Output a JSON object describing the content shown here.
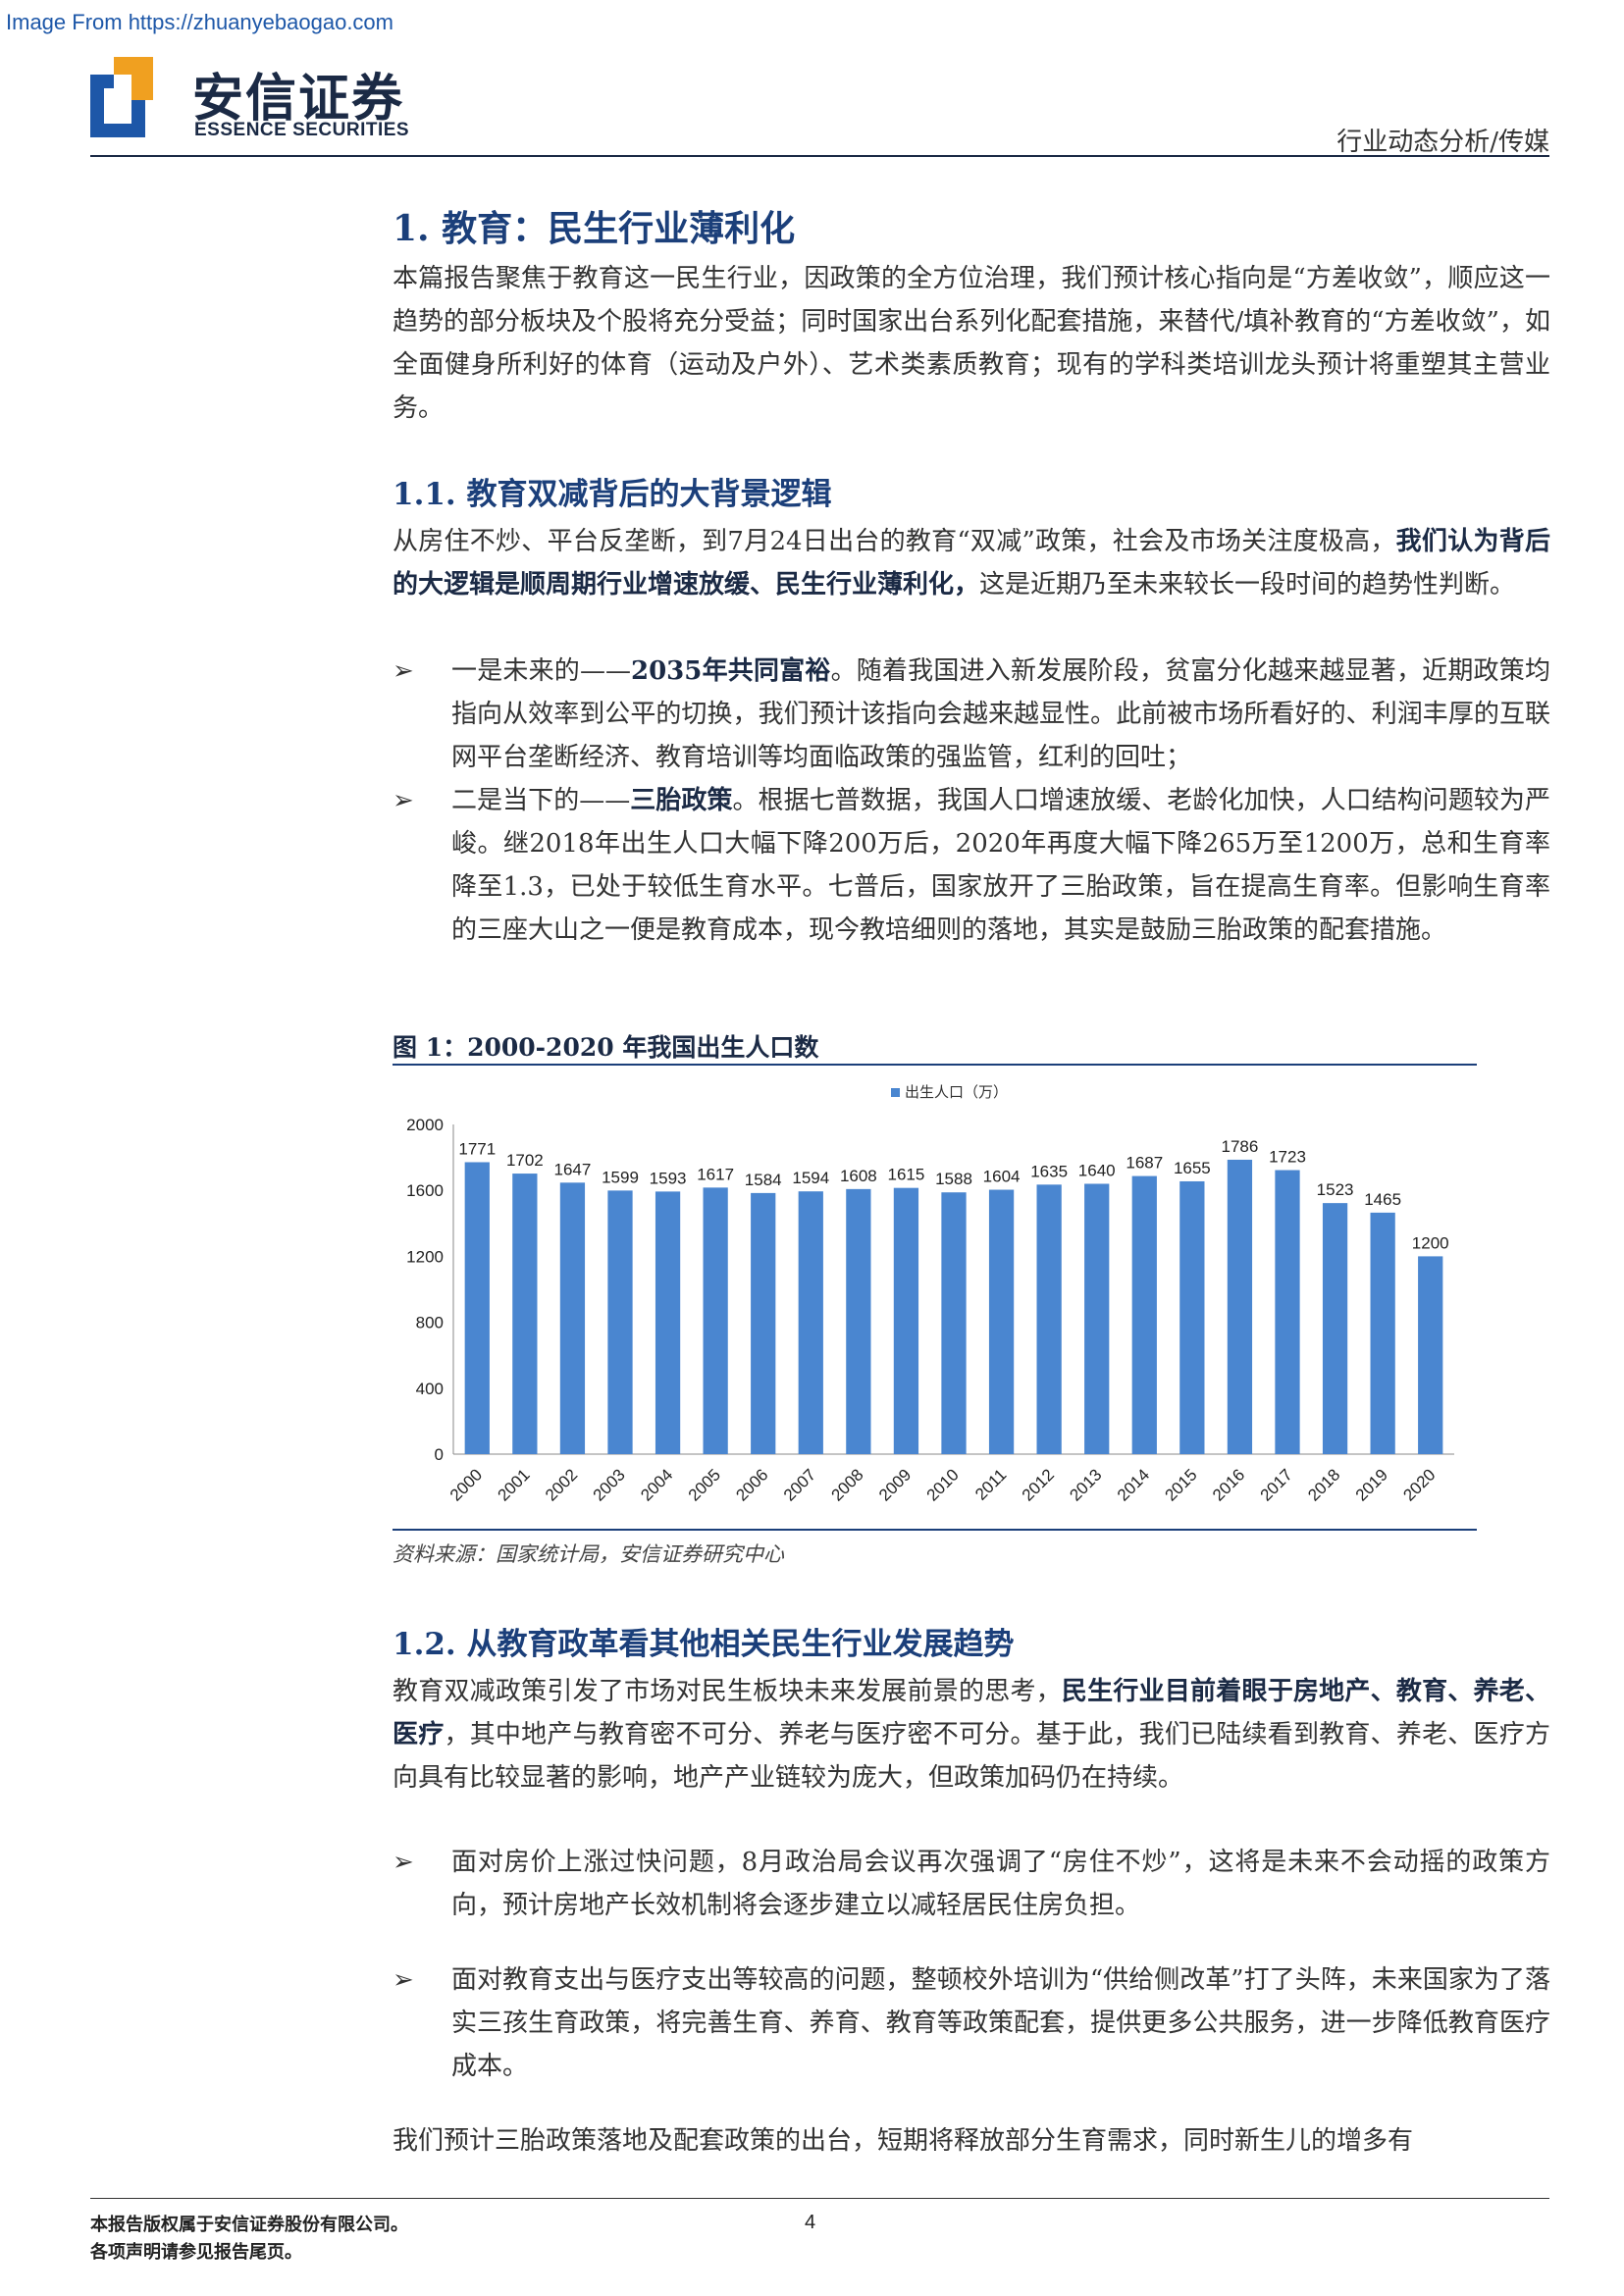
{
  "watermark": "Image From https://zhuanyebaogao.com",
  "logo": {
    "cn": "安信证券",
    "en": "ESSENCE SECURITIES",
    "brand_color": "#1d57a8",
    "accent_color": "#f0a020"
  },
  "header_right": "行业动态分析/传媒",
  "sec1": {
    "title": "1. 教育：民生行业薄利化",
    "para": "本篇报告聚焦于教育这一民生行业，因政策的全方位治理，我们预计核心指向是“方差收敛”，顺应这一趋势的部分板块及个股将充分受益；同时国家出台系列化配套措施，来替代/填补教育的“方差收敛”，如全面健身所利好的体育（运动及户外）、艺术类素质教育；现有的学科类培训龙头预计将重塑其主营业务。"
  },
  "sec11": {
    "title": "1.1. 教育双减背后的大背景逻辑",
    "para_a": "从房住不炒、平台反垄断，到7月24日出台的教育“双减”政策，社会及市场关注度极高，",
    "para_bold": "我们认为背后的大逻辑是顺周期行业增速放缓、民生行业薄利化，",
    "para_c": "这是近期乃至未来较长一段时间的趋势性判断。",
    "bullet1_a": "一是未来的——",
    "bullet1_bold": "2035年共同富裕",
    "bullet1_c": "。随着我国进入新发展阶段，贫富分化越来越显著，近期政策均指向从效率到公平的切换，我们预计该指向会越来越显性。此前被市场所看好的、利润丰厚的互联网平台垄断经济、教育培训等均面临政策的强监管，红利的回吐；",
    "bullet2_a": "二是当下的——",
    "bullet2_bold": "三胎政策",
    "bullet2_c": "。根据七普数据，我国人口增速放缓、老龄化加快，人口结构问题较为严峻。继2018年出生人口大幅下降200万后，2020年再度大幅下降265万至1200万，总和生育率降至1.3，已处于较低生育水平。七普后，国家放开了三胎政策，旨在提高生育率。但影响生育率的三座大山之一便是教育成本，现今教培细则的落地，其实是鼓励三胎政策的配套措施。"
  },
  "figure": {
    "title": "图 1：2000-2020 年我国出生人口数",
    "source": "资料来源：国家统计局，安信证券研究中心"
  },
  "chart_data": {
    "type": "bar",
    "categories": [
      "2000",
      "2001",
      "2002",
      "2003",
      "2004",
      "2005",
      "2006",
      "2007",
      "2008",
      "2009",
      "2010",
      "2011",
      "2012",
      "2013",
      "2014",
      "2015",
      "2016",
      "2017",
      "2018",
      "2019",
      "2020"
    ],
    "series": [
      {
        "name": "出生人口（万）",
        "values": [
          1771,
          1702,
          1647,
          1599,
          1593,
          1617,
          1584,
          1594,
          1608,
          1615,
          1588,
          1604,
          1635,
          1640,
          1687,
          1655,
          1786,
          1723,
          1523,
          1465,
          1200
        ]
      }
    ],
    "yticks": [
      "0",
      "400",
      "800",
      "1200",
      "1600",
      "2000"
    ],
    "ylim": [
      0,
      2000
    ],
    "bar_color": "#4a86d0",
    "legend_position": "top-center",
    "grid": false
  },
  "sec12": {
    "title": "1.2. 从教育政革看其他相关民生行业发展趋势",
    "para_a": "教育双减政策引发了市场对民生板块未来发展前景的思考，",
    "para_bold": "民生行业目前着眼于房地产、教育、养老、医疗",
    "para_c": "，其中地产与教育密不可分、养老与医疗密不可分。基于此，我们已陆续看到教育、养老、医疗方向具有比较显著的影响，地产产业链较为庞大，但政策加码仍在持续。",
    "bullet1": "面对房价上涨过快问题，8月政治局会议再次强调了“房住不炒”，这将是未来不会动摇的政策方向，预计房地产长效机制将会逐步建立以减轻居民住房负担。",
    "bullet2": "面对教育支出与医疗支出等较高的问题，整顿校外培训为“供给侧改革”打了头阵，未来国家为了落实三孩生育政策，将完善生育、养育、教育等政策配套，提供更多公共服务，进一步降低教育医疗成本。",
    "para_last": "我们预计三胎政策落地及配套政策的出台，短期将释放部分生育需求，同时新生儿的增多有"
  },
  "bullet_mark": "➢",
  "footer": {
    "line1": "本报告版权属于安信证券股份有限公司。",
    "line2": "各项声明请参见报告尾页。",
    "page": "4"
  }
}
